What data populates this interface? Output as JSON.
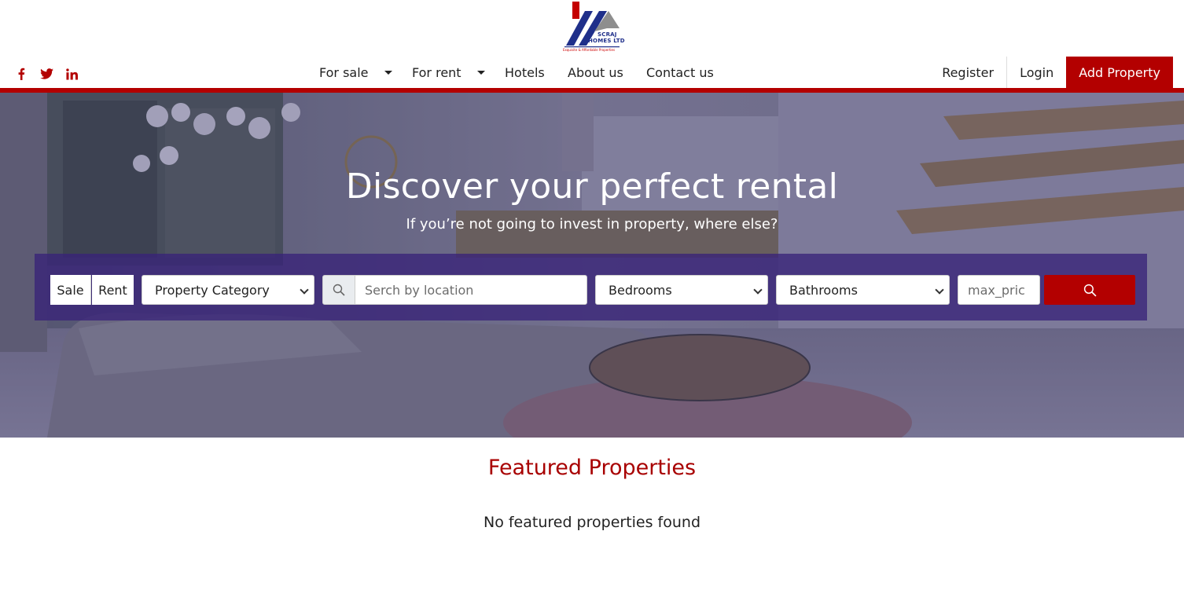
{
  "brand": {
    "name_line1": "SCRAJ",
    "name_line2": "HOMES LTD",
    "tagline": "Exquisite & Affordable Properties",
    "red": "#b30000",
    "blue": "#1f2f8a"
  },
  "social": [
    {
      "icon": "facebook-icon"
    },
    {
      "icon": "twitter-icon"
    },
    {
      "icon": "linkedin-icon"
    }
  ],
  "nav": {
    "for_sale": "For sale",
    "for_rent": "For rent",
    "hotels": "Hotels",
    "about": "About us",
    "contact": "Contact us"
  },
  "auth": {
    "register": "Register",
    "login": "Login",
    "add_property": "Add Property"
  },
  "hero": {
    "title": "Discover your perfect rental",
    "subtitle": "If you’re not going to invest in property, where else?"
  },
  "search": {
    "toggle_sale": "Sale",
    "toggle_rent": "Rent",
    "category": "Property Category",
    "location_placeholder": "Serch by location",
    "bedrooms": "Bedrooms",
    "bathrooms": "Bathrooms",
    "max_price_placeholder": "max_pric",
    "submit_icon": "search-icon"
  },
  "featured": {
    "title": "Featured Properties",
    "empty_message": "No featured properties found"
  }
}
